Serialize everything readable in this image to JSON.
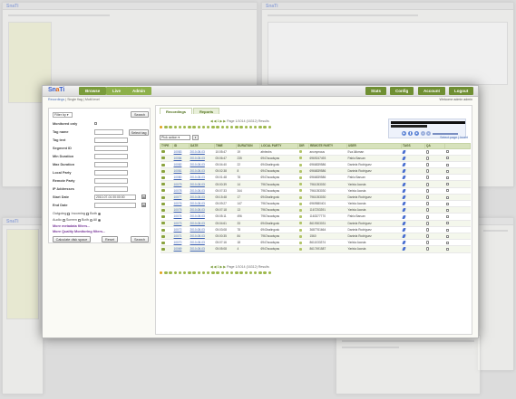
{
  "app": {
    "logo_part1": "Sn",
    "logo_part2": "a",
    "logo_part3": "Ti",
    "nav": [
      "Browse",
      "Live",
      "Admin"
    ],
    "right_nav": [
      "Stats",
      "Config",
      "Account",
      "Logout"
    ],
    "breadcrumbs": {
      "link1": "Recordings",
      "sep": " | ",
      "rest": "Single flag | Multi level"
    },
    "welcome": "Welcome admin admin"
  },
  "filters": {
    "filter_by_label": "Filter by",
    "search_btn": "Search",
    "rows": [
      {
        "label": "Monitored only",
        "kind": "checkbox"
      },
      {
        "label": "Tag name",
        "kind": "input",
        "value": ""
      },
      {
        "label": "Tag text",
        "kind": "input",
        "value": ""
      },
      {
        "label": "Segment ID",
        "kind": "input",
        "value": ""
      },
      {
        "label": "Min Duration",
        "kind": "input",
        "value": ""
      },
      {
        "label": "Max Duration",
        "kind": "input",
        "value": ""
      },
      {
        "label": "Local Party",
        "kind": "input",
        "value": ""
      },
      {
        "label": "Remote Party",
        "kind": "input",
        "value": ""
      },
      {
        "label": "IP Addresses",
        "kind": "input",
        "value": ""
      },
      {
        "label": "Start Date",
        "kind": "date",
        "value": "2010-07-01 00:00:00"
      },
      {
        "label": "End Date",
        "kind": "date",
        "value": ""
      }
    ],
    "select_tag_btn": "Select tag",
    "direction_label": "Outgoing",
    "direction_opts": [
      "Incoming",
      "Both"
    ],
    "audio_label": "Audio",
    "audio_opts": [
      "Screen",
      "Both",
      "All"
    ],
    "more_metadata": "More metadata filters...",
    "more_quality": "More Quality Monitoring filters...",
    "calc_btn": "Calculate disk space",
    "reset_btn": "Reset",
    "search_btn2": "Search"
  },
  "main": {
    "tabs": [
      "Recordings",
      "Reports"
    ],
    "pager_text": "Page 1/1014 (16312) Results",
    "action_select": "Pick action",
    "select_links": "Select page | Invert",
    "columns": [
      "TYPE",
      "ID",
      "DATE",
      "TIME",
      "DURATION",
      "LOCAL PARTY",
      "DIR",
      "REMOTE PARTY",
      "USER",
      "TAGS",
      "QA",
      ""
    ],
    "rows": [
      [
        "10083",
        "2010-08-03",
        "10:05:47",
        "19",
        "afntechs",
        "anonymous",
        "Eva Alloman"
      ],
      [
        "10084",
        "2010-08-03",
        "05:06:47",
        "235",
        "6947acadsyas",
        "6969247493",
        "Pablo Baruan"
      ],
      [
        "10082",
        "2010-08-03",
        "05:04:40",
        "22",
        "6943nalingosk",
        "6966839586",
        "Daniela Rodriguez"
      ],
      [
        "10081",
        "2010-08-03",
        "05:02:38",
        "8",
        "6947acadsyas",
        "6966839586",
        "Daniela Rodriguez"
      ],
      [
        "10080",
        "2010-08-03",
        "05:01:48",
        "78",
        "6947acadsyas",
        "6966839586",
        "Pablo Baruan"
      ],
      [
        "10079",
        "2010-08-03",
        "05:00:39",
        "14",
        "7967acadsyas",
        "7961053030",
        "Yarixia Acosta"
      ],
      [
        "10078",
        "2010-08-03",
        "05:07:33",
        "344",
        "7967acadsyas",
        "7961053030",
        "Yarixia Acosta"
      ],
      [
        "10077",
        "2010-08-03",
        "05:15:48",
        "17",
        "6943nalingosk",
        "7961053030",
        "Daniela Rodriguez"
      ],
      [
        "10076",
        "2010-08-03",
        "05:09:27",
        "147",
        "7967acadsyas",
        "6969580401",
        "Yarixia Acosta"
      ],
      [
        "10075",
        "2010-08-03",
        "05:07:18",
        "13",
        "7967acadsyas",
        "1167253391",
        "Yarixia Acosta"
      ],
      [
        "10074",
        "2010-08-03",
        "05:05:11",
        "496",
        "7967acadsyas",
        "1163377770",
        "Pablo Baruan"
      ],
      [
        "10073",
        "2010-08-03",
        "05:04:61",
        "33",
        "6943nalingosk",
        "8619303031",
        "Daniela Rodriguez"
      ],
      [
        "10072",
        "2010-08-03",
        "05:03:08",
        "78",
        "6943nalingosk",
        "3687761664",
        "Daniela Rodriguez"
      ],
      [
        "10071",
        "2010-08-03",
        "05:00:35",
        "84",
        "7967acadsyas",
        "1560",
        "Daniela Rodriguez"
      ],
      [
        "10070",
        "2010-08-03",
        "05:07:16",
        "18",
        "6947acadsyas",
        "8611033374",
        "Yarixia Acosta"
      ],
      [
        "10069",
        "2010-08-03",
        "05:05:08",
        "4",
        "6947acadsyas",
        "8617491587",
        "Yarixia Acosta"
      ]
    ]
  },
  "colors": {
    "accent": "#7a9c3b",
    "header": "#d7e2bc",
    "link": "#3d62b3"
  }
}
